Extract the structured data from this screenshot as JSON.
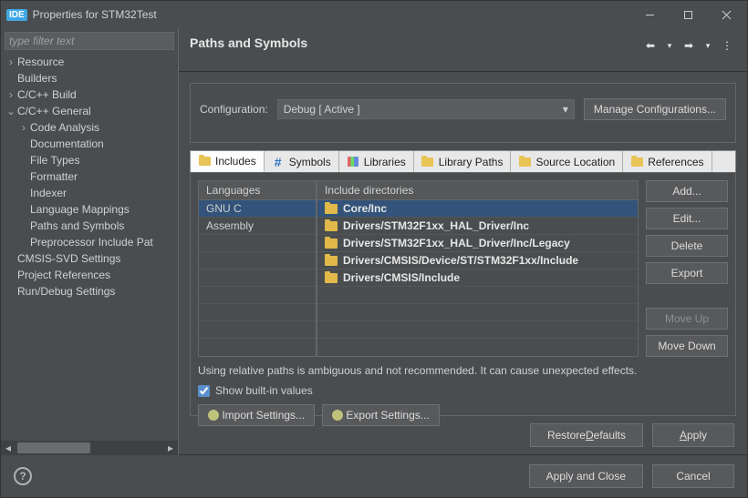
{
  "window": {
    "title": "Properties for STM32Test"
  },
  "filter": {
    "placeholder": "type filter text"
  },
  "tree": [
    {
      "label": "Resource",
      "depth": 0,
      "arrow": ">"
    },
    {
      "label": "Builders",
      "depth": 0,
      "arrow": ""
    },
    {
      "label": "C/C++ Build",
      "depth": 0,
      "arrow": ">"
    },
    {
      "label": "C/C++ General",
      "depth": 0,
      "arrow": "v"
    },
    {
      "label": "Code Analysis",
      "depth": 1,
      "arrow": ">"
    },
    {
      "label": "Documentation",
      "depth": 1,
      "arrow": ""
    },
    {
      "label": "File Types",
      "depth": 1,
      "arrow": ""
    },
    {
      "label": "Formatter",
      "depth": 1,
      "arrow": ""
    },
    {
      "label": "Indexer",
      "depth": 1,
      "arrow": ""
    },
    {
      "label": "Language Mappings",
      "depth": 1,
      "arrow": ""
    },
    {
      "label": "Paths and Symbols",
      "depth": 1,
      "arrow": ""
    },
    {
      "label": "Preprocessor Include Pat",
      "depth": 1,
      "arrow": ""
    },
    {
      "label": "CMSIS-SVD Settings",
      "depth": 0,
      "arrow": ""
    },
    {
      "label": "Project References",
      "depth": 0,
      "arrow": ""
    },
    {
      "label": "Run/Debug Settings",
      "depth": 0,
      "arrow": ""
    }
  ],
  "page": {
    "title": "Paths and Symbols",
    "config_label": "Configuration:",
    "config_value": "Debug  [ Active ]",
    "manage": "Manage Configurations..."
  },
  "tabs": [
    "Includes",
    "Symbols",
    "Libraries",
    "Library Paths",
    "Source Location",
    "References"
  ],
  "langs_head": "Languages",
  "dirs_head": "Include directories",
  "langs": [
    "GNU C",
    "Assembly"
  ],
  "dirs": [
    "Core/Inc",
    "Drivers/STM32F1xx_HAL_Driver/Inc",
    "Drivers/STM32F1xx_HAL_Driver/Inc/Legacy",
    "Drivers/CMSIS/Device/ST/STM32F1xx/Include",
    "Drivers/CMSIS/Include"
  ],
  "buttons": {
    "add": "Add...",
    "edit": "Edit...",
    "delete": "Delete",
    "export": "Export",
    "moveup": "Move Up",
    "movedown": "Move Down"
  },
  "note": "Using relative paths is ambiguous and not recommended. It can cause unexpected effects.",
  "showbuiltin": "Show built-in values",
  "import": "Import Settings...",
  "exportset": "Export Settings...",
  "restore_pre": "Restore ",
  "restore_u": "D",
  "restore_post": "efaults",
  "apply_u": "A",
  "apply_post": "pply",
  "applyclose": "Apply and Close",
  "cancel": "Cancel"
}
